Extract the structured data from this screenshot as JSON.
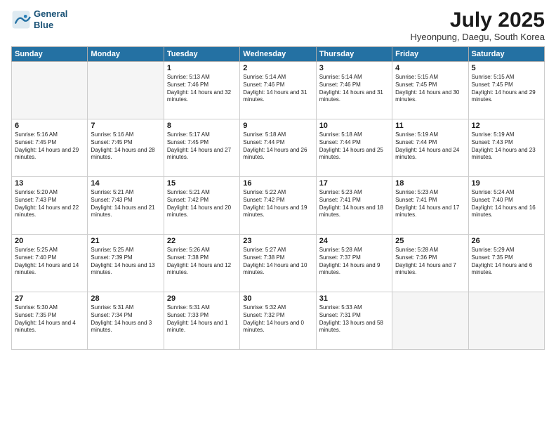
{
  "header": {
    "logo_line1": "General",
    "logo_line2": "Blue",
    "month_title": "July 2025",
    "location": "Hyeonpung, Daegu, South Korea"
  },
  "weekdays": [
    "Sunday",
    "Monday",
    "Tuesday",
    "Wednesday",
    "Thursday",
    "Friday",
    "Saturday"
  ],
  "weeks": [
    [
      {
        "day": "",
        "empty": true
      },
      {
        "day": "",
        "empty": true
      },
      {
        "day": "1",
        "sunrise": "5:13 AM",
        "sunset": "7:46 PM",
        "daylight": "14 hours and 32 minutes."
      },
      {
        "day": "2",
        "sunrise": "5:14 AM",
        "sunset": "7:46 PM",
        "daylight": "14 hours and 31 minutes."
      },
      {
        "day": "3",
        "sunrise": "5:14 AM",
        "sunset": "7:46 PM",
        "daylight": "14 hours and 31 minutes."
      },
      {
        "day": "4",
        "sunrise": "5:15 AM",
        "sunset": "7:45 PM",
        "daylight": "14 hours and 30 minutes."
      },
      {
        "day": "5",
        "sunrise": "5:15 AM",
        "sunset": "7:45 PM",
        "daylight": "14 hours and 29 minutes."
      }
    ],
    [
      {
        "day": "6",
        "sunrise": "5:16 AM",
        "sunset": "7:45 PM",
        "daylight": "14 hours and 29 minutes."
      },
      {
        "day": "7",
        "sunrise": "5:16 AM",
        "sunset": "7:45 PM",
        "daylight": "14 hours and 28 minutes."
      },
      {
        "day": "8",
        "sunrise": "5:17 AM",
        "sunset": "7:45 PM",
        "daylight": "14 hours and 27 minutes."
      },
      {
        "day": "9",
        "sunrise": "5:18 AM",
        "sunset": "7:44 PM",
        "daylight": "14 hours and 26 minutes."
      },
      {
        "day": "10",
        "sunrise": "5:18 AM",
        "sunset": "7:44 PM",
        "daylight": "14 hours and 25 minutes."
      },
      {
        "day": "11",
        "sunrise": "5:19 AM",
        "sunset": "7:44 PM",
        "daylight": "14 hours and 24 minutes."
      },
      {
        "day": "12",
        "sunrise": "5:19 AM",
        "sunset": "7:43 PM",
        "daylight": "14 hours and 23 minutes."
      }
    ],
    [
      {
        "day": "13",
        "sunrise": "5:20 AM",
        "sunset": "7:43 PM",
        "daylight": "14 hours and 22 minutes."
      },
      {
        "day": "14",
        "sunrise": "5:21 AM",
        "sunset": "7:43 PM",
        "daylight": "14 hours and 21 minutes."
      },
      {
        "day": "15",
        "sunrise": "5:21 AM",
        "sunset": "7:42 PM",
        "daylight": "14 hours and 20 minutes."
      },
      {
        "day": "16",
        "sunrise": "5:22 AM",
        "sunset": "7:42 PM",
        "daylight": "14 hours and 19 minutes."
      },
      {
        "day": "17",
        "sunrise": "5:23 AM",
        "sunset": "7:41 PM",
        "daylight": "14 hours and 18 minutes."
      },
      {
        "day": "18",
        "sunrise": "5:23 AM",
        "sunset": "7:41 PM",
        "daylight": "14 hours and 17 minutes."
      },
      {
        "day": "19",
        "sunrise": "5:24 AM",
        "sunset": "7:40 PM",
        "daylight": "14 hours and 16 minutes."
      }
    ],
    [
      {
        "day": "20",
        "sunrise": "5:25 AM",
        "sunset": "7:40 PM",
        "daylight": "14 hours and 14 minutes."
      },
      {
        "day": "21",
        "sunrise": "5:25 AM",
        "sunset": "7:39 PM",
        "daylight": "14 hours and 13 minutes."
      },
      {
        "day": "22",
        "sunrise": "5:26 AM",
        "sunset": "7:38 PM",
        "daylight": "14 hours and 12 minutes."
      },
      {
        "day": "23",
        "sunrise": "5:27 AM",
        "sunset": "7:38 PM",
        "daylight": "14 hours and 10 minutes."
      },
      {
        "day": "24",
        "sunrise": "5:28 AM",
        "sunset": "7:37 PM",
        "daylight": "14 hours and 9 minutes."
      },
      {
        "day": "25",
        "sunrise": "5:28 AM",
        "sunset": "7:36 PM",
        "daylight": "14 hours and 7 minutes."
      },
      {
        "day": "26",
        "sunrise": "5:29 AM",
        "sunset": "7:35 PM",
        "daylight": "14 hours and 6 minutes."
      }
    ],
    [
      {
        "day": "27",
        "sunrise": "5:30 AM",
        "sunset": "7:35 PM",
        "daylight": "14 hours and 4 minutes."
      },
      {
        "day": "28",
        "sunrise": "5:31 AM",
        "sunset": "7:34 PM",
        "daylight": "14 hours and 3 minutes."
      },
      {
        "day": "29",
        "sunrise": "5:31 AM",
        "sunset": "7:33 PM",
        "daylight": "14 hours and 1 minute."
      },
      {
        "day": "30",
        "sunrise": "5:32 AM",
        "sunset": "7:32 PM",
        "daylight": "14 hours and 0 minutes."
      },
      {
        "day": "31",
        "sunrise": "5:33 AM",
        "sunset": "7:31 PM",
        "daylight": "13 hours and 58 minutes."
      },
      {
        "day": "",
        "empty": true
      },
      {
        "day": "",
        "empty": true
      }
    ]
  ]
}
